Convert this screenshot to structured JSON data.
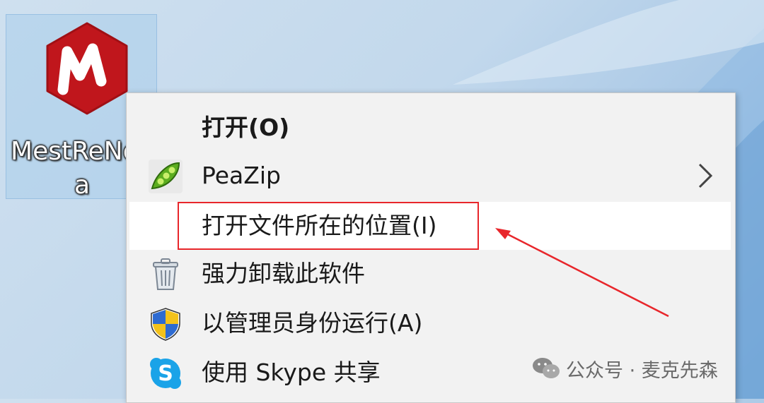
{
  "desktop": {
    "icon_label": "MestReNova"
  },
  "context_menu": {
    "items": [
      {
        "label": "打开(O)",
        "icon": "none",
        "bold": true
      },
      {
        "label": "PeaZip",
        "icon": "peazip-icon",
        "has_submenu": true
      },
      {
        "label": "打开文件所在的位置(I)",
        "icon": "none",
        "hovered": true
      },
      {
        "label": "强力卸载此软件",
        "icon": "trash-icon"
      },
      {
        "label": "以管理员身份运行(A)",
        "icon": "uac-shield-icon"
      },
      {
        "label": "使用 Skype 共享",
        "icon": "skype-icon"
      }
    ]
  },
  "annotation": {
    "color": "#e8262b"
  },
  "watermark": {
    "text": "公众号 · 麦克先森"
  },
  "colors": {
    "logo_red": "#c0161c",
    "menu_bg": "#f2f2f2",
    "hover_bg": "#ffffff"
  }
}
